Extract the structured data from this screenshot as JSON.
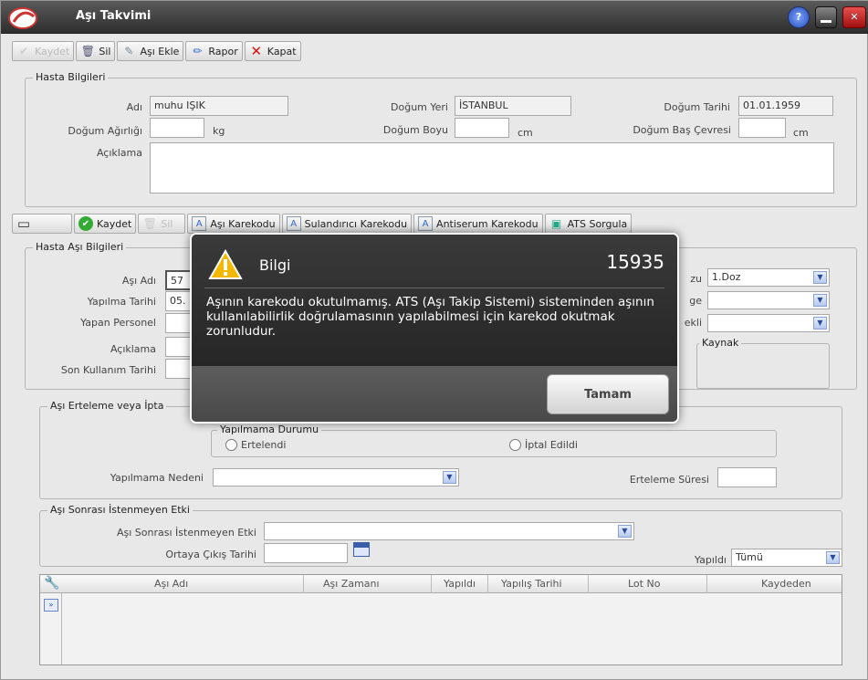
{
  "window": {
    "title": "Aşı Takvimi"
  },
  "toolbar": [
    {
      "label": "Kaydet",
      "icon": "check-icon",
      "disabled": true
    },
    {
      "label": "Sil",
      "icon": "trash-icon",
      "disabled": false
    },
    {
      "label": "Aşı Ekle",
      "icon": "syringe-icon",
      "disabled": false
    },
    {
      "label": "Rapor",
      "icon": "pencil-icon",
      "disabled": false
    },
    {
      "label": "Kapat",
      "icon": "close-icon",
      "disabled": false
    }
  ],
  "patient": {
    "legend": "Hasta Bilgileri",
    "name_label": "Adı",
    "name_value": "muhu IŞIK",
    "birthplace_label": "Doğum Yeri",
    "birthplace_value": "İSTANBUL",
    "birthdate_label": "Doğum Tarihi",
    "birthdate_value": "01.01.1959",
    "weight_label": "Doğum Ağırlığı",
    "weight_unit": "kg",
    "height_label": "Doğum Boyu",
    "height_unit": "cm",
    "head_label": "Doğum Baş Çevresi",
    "head_unit": "cm",
    "desc_label": "Açıklama"
  },
  "tabs": [
    {
      "label": "",
      "icon": "new-doc-icon",
      "disabled": true
    },
    {
      "label": "Kaydet",
      "icon": "check-icon",
      "disabled": false
    },
    {
      "label": "Sil",
      "icon": "trash-icon",
      "disabled": true
    },
    {
      "label": "Aşı Karekodu",
      "icon": "barcode-icon",
      "disabled": false
    },
    {
      "label": "Sulandırıcı Karekodu",
      "icon": "barcode-icon",
      "disabled": false
    },
    {
      "label": "Antiserum Karekodu",
      "icon": "barcode-icon",
      "disabled": false
    },
    {
      "label": "ATS Sorgula",
      "icon": "query-icon",
      "disabled": false
    }
  ],
  "vaccine": {
    "legend": "Hasta Aşı Bilgileri",
    "name_label": "Aşı Adı",
    "name_value": "57",
    "date_label": "Yapılma Tarihi",
    "date_value": "05.",
    "staff_label": "Yapan Personel",
    "desc_label": "Açıklama",
    "expiry_label": "Son Kullanım Tarihi",
    "dose_label": "zu",
    "dose_value": "1.Doz",
    "region_label": "ge",
    "method_label": "ekli",
    "source_label": "Kaynak"
  },
  "postpone": {
    "legend": "Aşı Erteleme veya İpta",
    "status_legend": "Yapılmama Durumu",
    "opt1": "Ertelendi",
    "opt2": "İptal Edildi",
    "reason_label": "Yapılmama Nedeni",
    "duration_label": "Erteleme Süresi"
  },
  "adverse": {
    "legend": "Aşı Sonrası İstenmeyen Etki",
    "effect_label": "Aşı Sonrası İstenmeyen Etki",
    "date_label": "Ortaya Çıkış Tarihi",
    "done_label": "Yapıldı",
    "done_value": "Tümü"
  },
  "grid": {
    "columns": [
      "Aşı Adı",
      "Aşı Zamanı",
      "Yapıldı",
      "Yapılış Tarihi",
      "Lot No",
      "Kaydeden"
    ]
  },
  "dialog": {
    "title": "Bilgi",
    "code": "15935",
    "message": "Aşının karekodu okutulmamış. ATS (Aşı Takip Sistemi) sisteminden aşının kullanılabilirlik doğrulamasının yapılabilmesi için karekod okutmak zorunludur.",
    "ok_label": "Tamam"
  },
  "colors": {
    "accent": "#2b4b93",
    "warning": "#f5b800",
    "dialog_bg": "#2e2e2e"
  }
}
